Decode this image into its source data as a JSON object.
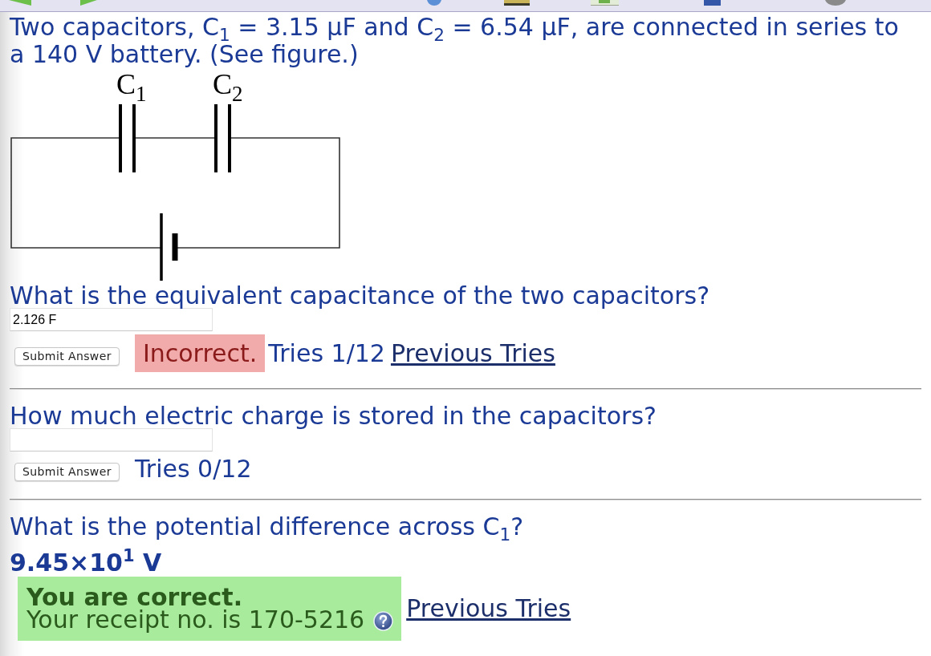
{
  "problem": {
    "text": "Two capacitors, C$_{1}$ = 3.15 μF and C$_{2}$ = 6.54 μF, are connected in series to a 140 V battery. (See figure.)",
    "figure": {
      "labels": [
        "C$_{1}$",
        "C$_{2}$"
      ]
    }
  },
  "questions": [
    {
      "kind": "entry",
      "prompt": "What is the equivalent capacitance of the two capacitors?",
      "value": "2.126 F",
      "button": "Submit Answer",
      "correct": false,
      "status_text": "Incorrect.",
      "tries": "Tries 1/12",
      "link": "Previous Tries"
    },
    {
      "kind": "entry",
      "prompt": "How much electric charge is stored in the capacitors?",
      "button": "Submit Answer",
      "tries": "Tries 0/12"
    },
    {
      "kind": "answered",
      "prompt": "What is the potential difference across C$_{1}$?",
      "answer": "9.45×10$^{1}$ V",
      "correct": true,
      "status_text": "You are correct.",
      "receipt": "Your receipt no. is 170-5216",
      "link": "Previous Tries"
    }
  ]
}
